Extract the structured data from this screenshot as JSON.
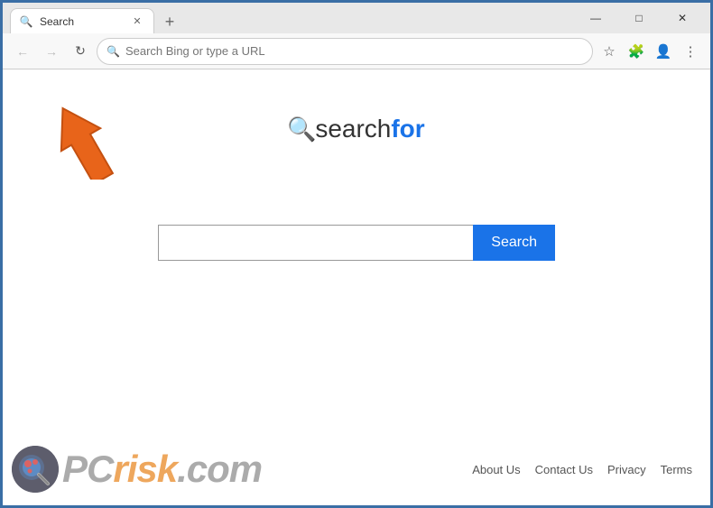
{
  "browser": {
    "tab": {
      "title": "Search",
      "favicon": "🔍"
    },
    "new_tab_label": "+",
    "window_controls": {
      "minimize": "—",
      "maximize": "□",
      "close": "✕"
    },
    "nav": {
      "back_label": "←",
      "forward_label": "→",
      "refresh_label": "↻",
      "address_placeholder": "Search Bing or type a URL",
      "address_value": "Search Bing or type a URL"
    },
    "toolbar": {
      "favorites_label": "☆",
      "extensions_label": "🧩",
      "profile_label": "👤",
      "menu_label": "⋮"
    }
  },
  "page": {
    "logo": {
      "icon": "🔍",
      "text_before": "search",
      "text_bold": "for"
    },
    "search": {
      "placeholder": "",
      "button_label": "Search"
    }
  },
  "footer": {
    "links": [
      {
        "label": "About Us"
      },
      {
        "label": "Contact Us"
      },
      {
        "label": "Privacy"
      },
      {
        "label": "Terms"
      }
    ]
  }
}
